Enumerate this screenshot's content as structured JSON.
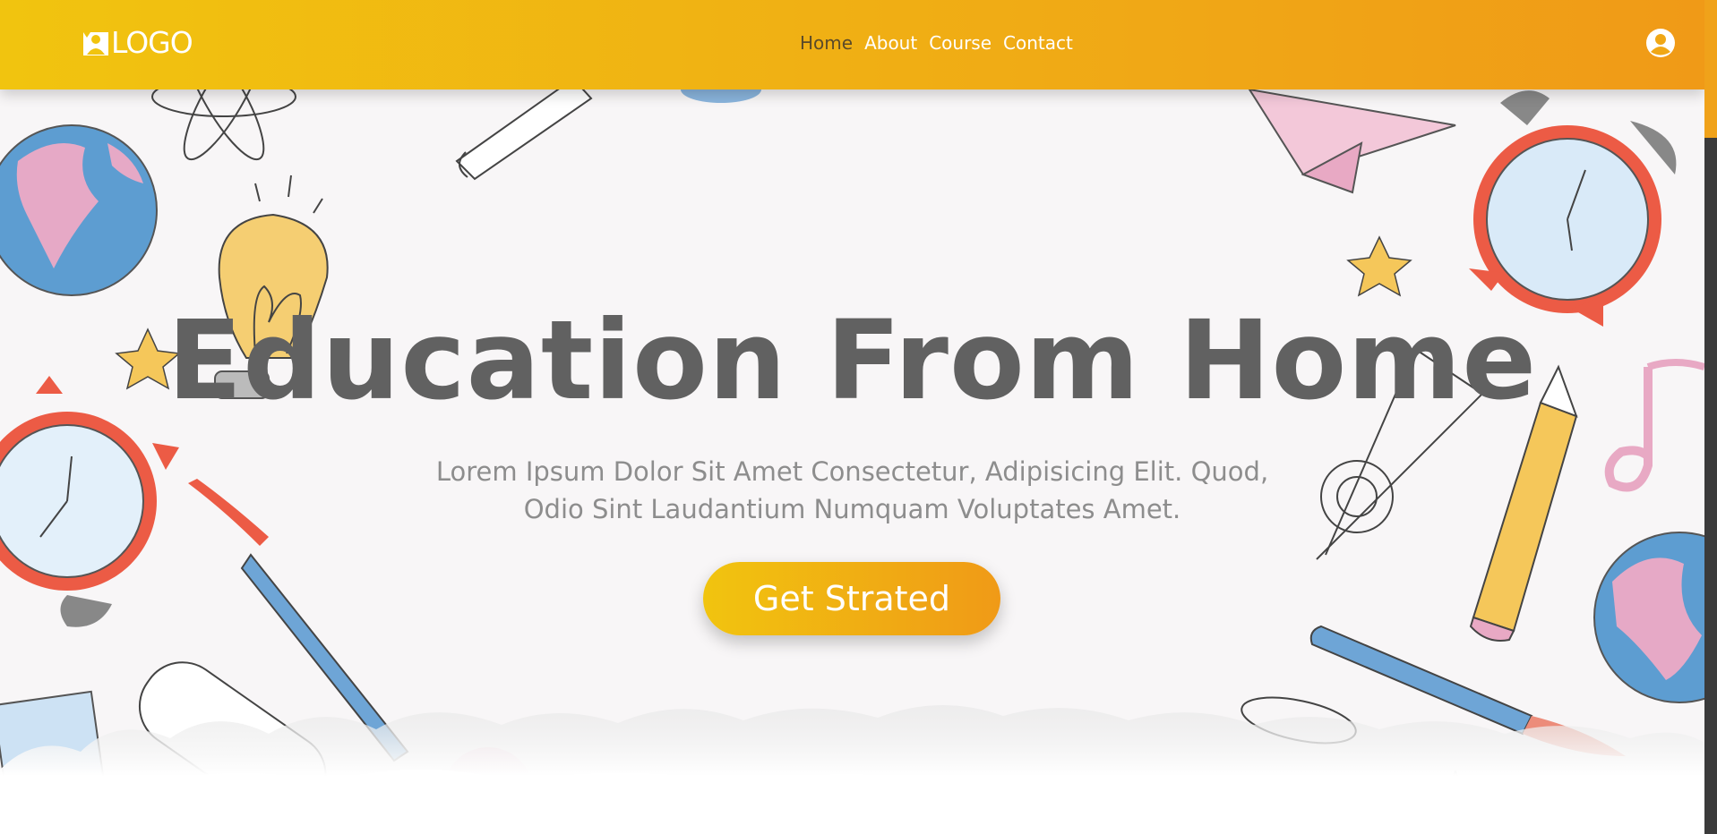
{
  "brand": {
    "logo_text": "LOGO"
  },
  "nav": {
    "items": [
      {
        "label": "Home",
        "active": true
      },
      {
        "label": "About"
      },
      {
        "label": "Course"
      },
      {
        "label": "Contact"
      }
    ]
  },
  "hero": {
    "title": "Education From Home",
    "subtitle": "Lorem Ipsum Dolor Sit Amet Consectetur, Adipisicing Elit. Quod, Odio Sint Laudantium Numquam Voluptates Amet.",
    "cta_label": "Get Strated"
  },
  "colors": {
    "gradient_start": "#f1c40f",
    "gradient_end": "#f09a17",
    "title": "#616161",
    "subtitle": "#8d8d8d"
  },
  "icons": [
    "user-icon",
    "logo-icon"
  ]
}
